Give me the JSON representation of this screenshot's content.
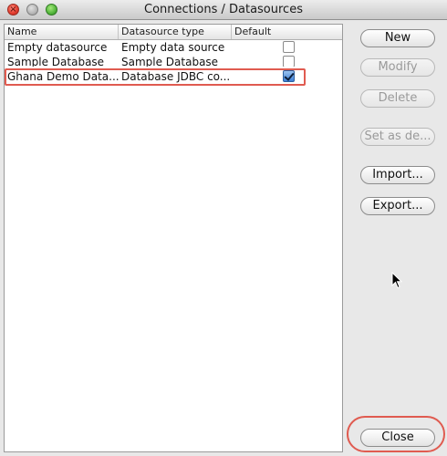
{
  "window": {
    "title": "Connections / Datasources"
  },
  "table": {
    "headers": {
      "name": "Name",
      "type": "Datasource type",
      "default": "Default"
    },
    "rows": [
      {
        "name": "Empty datasource",
        "type": "Empty data source",
        "default": false
      },
      {
        "name": "Sample Database",
        "type": "Sample Database",
        "default": false
      },
      {
        "name": "Ghana Demo Data...",
        "type": "Database JDBC co...",
        "default": true
      }
    ]
  },
  "buttons": {
    "new": "New",
    "modify": "Modify",
    "delete": "Delete",
    "set_default": "Set as de...",
    "import": "Import...",
    "export": "Export...",
    "close": "Close"
  },
  "colors": {
    "highlight": "#e05b50"
  },
  "icons": [
    "close-window-icon",
    "minimize-window-icon",
    "zoom-window-icon",
    "mouse-pointer-icon"
  ]
}
